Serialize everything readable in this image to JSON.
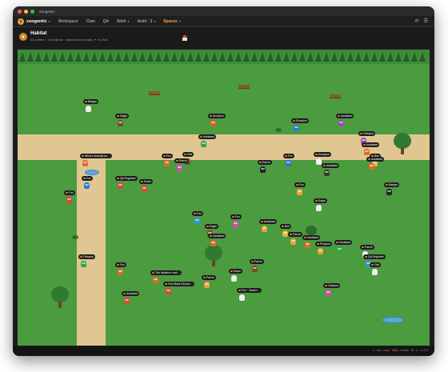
{
  "window": {
    "title": "Zoogentic"
  },
  "nav": {
    "brand": "zoogentic",
    "tabs": [
      {
        "label": "Workspace",
        "active": false
      },
      {
        "label": "Claw",
        "active": false
      },
      {
        "label": "QA",
        "active": false
      },
      {
        "label": "Work",
        "active": false,
        "chevron": true
      },
      {
        "label": "Audit · 3",
        "active": false,
        "chevron": true
      },
      {
        "label": "Spaces",
        "active": true,
        "chevron": true
      }
    ]
  },
  "header": {
    "title": "Habitat",
    "subtitle": "54 critters · 14 projects · arrow keys to walk, ↵ to chat"
  },
  "critters": [
    {
      "name": "Badger",
      "color": "#eeeeee"
    },
    {
      "name": "Eagle",
      "color": "#7a4a2a"
    },
    {
      "name": "Scorpion",
      "color": "#d8622a"
    },
    {
      "name": "Assistant",
      "color": "#9a4ab0"
    },
    {
      "name": "Scorpion",
      "color": "#2a7ad8"
    },
    {
      "name": "Octopus",
      "color": "#9a4ab0"
    },
    {
      "name": "Assistant",
      "color": "#e06b2a"
    },
    {
      "name": "Assistant",
      "color": "#2aa84a"
    },
    {
      "name": "Fox",
      "color": "#e06b2a"
    },
    {
      "name": "Owl",
      "color": "#7a4a2a"
    },
    {
      "name": "Parrot",
      "color": "#d84ab0"
    },
    {
      "name": "What's actually pe…",
      "color": "#e06b2a"
    },
    {
      "name": "Parrot",
      "color": "#222222"
    },
    {
      "name": "Fox",
      "color": "#2a7ad8"
    },
    {
      "name": "Scorpion",
      "color": "#eeeeee"
    },
    {
      "name": "Assistant",
      "color": "#333333"
    },
    {
      "name": "Bee",
      "color": "#e9b33a"
    },
    {
      "name": "Assistant",
      "color": "#e06b2a"
    },
    {
      "name": "Fox",
      "color": "#2a7ad8"
    },
    {
      "name": "QA Engineer",
      "color": "#d84a3a"
    },
    {
      "name": "Swan",
      "color": "#d84a3a"
    },
    {
      "name": "Fox",
      "color": "#d84a3a"
    },
    {
      "name": "Fox",
      "color": "#e9a33a"
    },
    {
      "name": "Eagle",
      "color": "#eeeeee"
    },
    {
      "name": "Badger",
      "color": "#222222"
    },
    {
      "name": "Fox",
      "color": "#2a9ad8"
    },
    {
      "name": "Fox",
      "color": "#d84ab0"
    },
    {
      "name": "Eagle",
      "color": "#7a4a2a"
    },
    {
      "name": "Assistant",
      "color": "#e9a33a"
    },
    {
      "name": "Assistant",
      "color": "#e06b2a"
    },
    {
      "name": "Bee",
      "color": "#e9b33a"
    },
    {
      "name": "Parrot",
      "color": "#e9a33a"
    },
    {
      "name": "Assistant",
      "color": "#e06b2a"
    },
    {
      "name": "Penguin",
      "color": "#e9a33a"
    },
    {
      "name": "Assistant",
      "color": "#2aa84a"
    },
    {
      "name": "Parrot",
      "color": "#eeeeee"
    },
    {
      "name": "QA Engineer",
      "color": "#2a9ad8"
    },
    {
      "name": "Owl",
      "color": "#eeeeee"
    },
    {
      "name": "Octopus",
      "color": "#2aa84a"
    },
    {
      "name": "Fox",
      "color": "#e06b2a"
    },
    {
      "name": "Parrot",
      "color": "#7a4a2a"
    },
    {
      "name": "The isolation mod…",
      "color": "#e06b2a"
    },
    {
      "name": "Parrot",
      "color": "#e9a33a"
    },
    {
      "name": "Full-Stack Develo…",
      "color": "#d84a3a"
    },
    {
      "name": "Swan",
      "color": "#eeeeee"
    },
    {
      "name": "Fox · Tavern…",
      "color": "#eeeeee"
    },
    {
      "name": "Assistant",
      "color": "#d84a3a"
    },
    {
      "name": "Octopus",
      "color": "#d84ab0"
    }
  ],
  "status": {
    "items": [
      {
        "text": "4",
        "tone": "muted"
      },
      {
        "text": "live",
        "tone": "muted"
      },
      {
        "text": "noop",
        "tone": "a"
      },
      {
        "text": "1410",
        "tone": "b"
      },
      {
        "text": "format",
        "tone": "muted"
      },
      {
        "text": "55",
        "tone": "muted"
      },
      {
        "text": "0",
        "tone": "muted"
      },
      {
        "text": "v1.2.0",
        "tone": "muted"
      }
    ]
  },
  "colors": {
    "grass": "#4b9b3f",
    "path": "#e0c690",
    "forest": "#1f5e28",
    "accent": "#f0a540"
  }
}
